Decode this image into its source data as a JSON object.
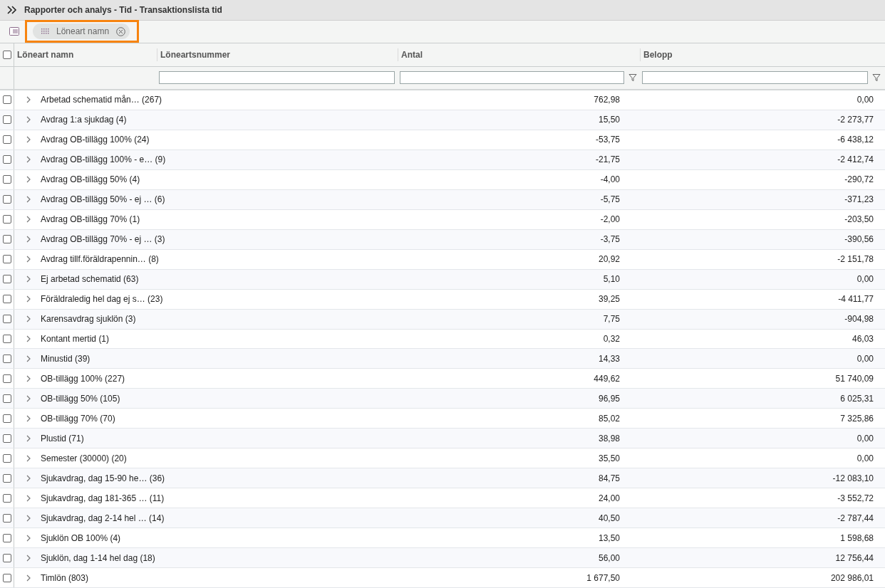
{
  "title": "Rapporter och analys - Tid - Transaktionslista tid",
  "group_chip": {
    "label": "Löneart namn",
    "highlighted": true
  },
  "select_all": {
    "checked": false
  },
  "columns": [
    {
      "label": "Löneart namn",
      "filter": false
    },
    {
      "label": "Löneartsnummer",
      "filter": false
    },
    {
      "label": "Antal",
      "filter": true
    },
    {
      "label": "Belopp",
      "filter": true
    }
  ],
  "rows": [
    {
      "name": "Arbetad schematid mån… (267)",
      "antal": "762,98",
      "belopp": "0,00",
      "checked": false,
      "expanded": false
    },
    {
      "name": "Avdrag 1:a sjukdag (4)",
      "antal": "15,50",
      "belopp": "-2 273,77",
      "checked": false,
      "expanded": false
    },
    {
      "name": "Avdrag OB-tillägg 100% (24)",
      "antal": "-53,75",
      "belopp": "-6 438,12",
      "checked": false,
      "expanded": false
    },
    {
      "name": "Avdrag OB-tillägg 100% - e… (9)",
      "antal": "-21,75",
      "belopp": "-2 412,74",
      "checked": false,
      "expanded": false
    },
    {
      "name": "Avdrag OB-tillägg 50% (4)",
      "antal": "-4,00",
      "belopp": "-290,72",
      "checked": false,
      "expanded": false
    },
    {
      "name": "Avdrag OB-tillägg 50% - ej … (6)",
      "antal": "-5,75",
      "belopp": "-371,23",
      "checked": false,
      "expanded": false
    },
    {
      "name": "Avdrag OB-tillägg 70% (1)",
      "antal": "-2,00",
      "belopp": "-203,50",
      "checked": false,
      "expanded": false
    },
    {
      "name": "Avdrag OB-tillägg 70% - ej … (3)",
      "antal": "-3,75",
      "belopp": "-390,56",
      "checked": false,
      "expanded": false
    },
    {
      "name": "Avdrag tillf.föräldrapennin… (8)",
      "antal": "20,92",
      "belopp": "-2 151,78",
      "checked": false,
      "expanded": false
    },
    {
      "name": "Ej arbetad schematid (63)",
      "antal": "5,10",
      "belopp": "0,00",
      "checked": false,
      "expanded": false
    },
    {
      "name": "Föräldraledig hel dag ej s… (23)",
      "antal": "39,25",
      "belopp": "-4 411,77",
      "checked": false,
      "expanded": false
    },
    {
      "name": "Karensavdrag sjuklön (3)",
      "antal": "7,75",
      "belopp": "-904,98",
      "checked": false,
      "expanded": false
    },
    {
      "name": "Kontant mertid (1)",
      "antal": "0,32",
      "belopp": "46,03",
      "checked": false,
      "expanded": false
    },
    {
      "name": "Minustid (39)",
      "antal": "14,33",
      "belopp": "0,00",
      "checked": false,
      "expanded": false
    },
    {
      "name": "OB-tillägg 100% (227)",
      "antal": "449,62",
      "belopp": "51 740,09",
      "checked": false,
      "expanded": false
    },
    {
      "name": "OB-tillägg 50% (105)",
      "antal": "96,95",
      "belopp": "6 025,31",
      "checked": false,
      "expanded": false
    },
    {
      "name": "OB-tillägg 70% (70)",
      "antal": "85,02",
      "belopp": "7 325,86",
      "checked": false,
      "expanded": false
    },
    {
      "name": "Plustid (71)",
      "antal": "38,98",
      "belopp": "0,00",
      "checked": false,
      "expanded": false
    },
    {
      "name": "Semester (30000) (20)",
      "antal": "35,50",
      "belopp": "0,00",
      "checked": false,
      "expanded": false
    },
    {
      "name": "Sjukavdrag, dag 15-90 he… (36)",
      "antal": "84,75",
      "belopp": "-12 083,10",
      "checked": false,
      "expanded": false
    },
    {
      "name": "Sjukavdrag, dag 181-365 … (11)",
      "antal": "24,00",
      "belopp": "-3 552,72",
      "checked": false,
      "expanded": false
    },
    {
      "name": "Sjukavdrag, dag 2-14 hel … (14)",
      "antal": "40,50",
      "belopp": "-2 787,44",
      "checked": false,
      "expanded": false
    },
    {
      "name": "Sjuklön OB 100% (4)",
      "antal": "13,50",
      "belopp": "1 598,68",
      "checked": false,
      "expanded": false
    },
    {
      "name": "Sjuklön, dag 1-14 hel dag (18)",
      "antal": "56,00",
      "belopp": "12 756,44",
      "checked": false,
      "expanded": false
    },
    {
      "name": "Timlön (803)",
      "antal": "1 677,50",
      "belopp": "202 986,01",
      "checked": false,
      "expanded": false
    }
  ]
}
